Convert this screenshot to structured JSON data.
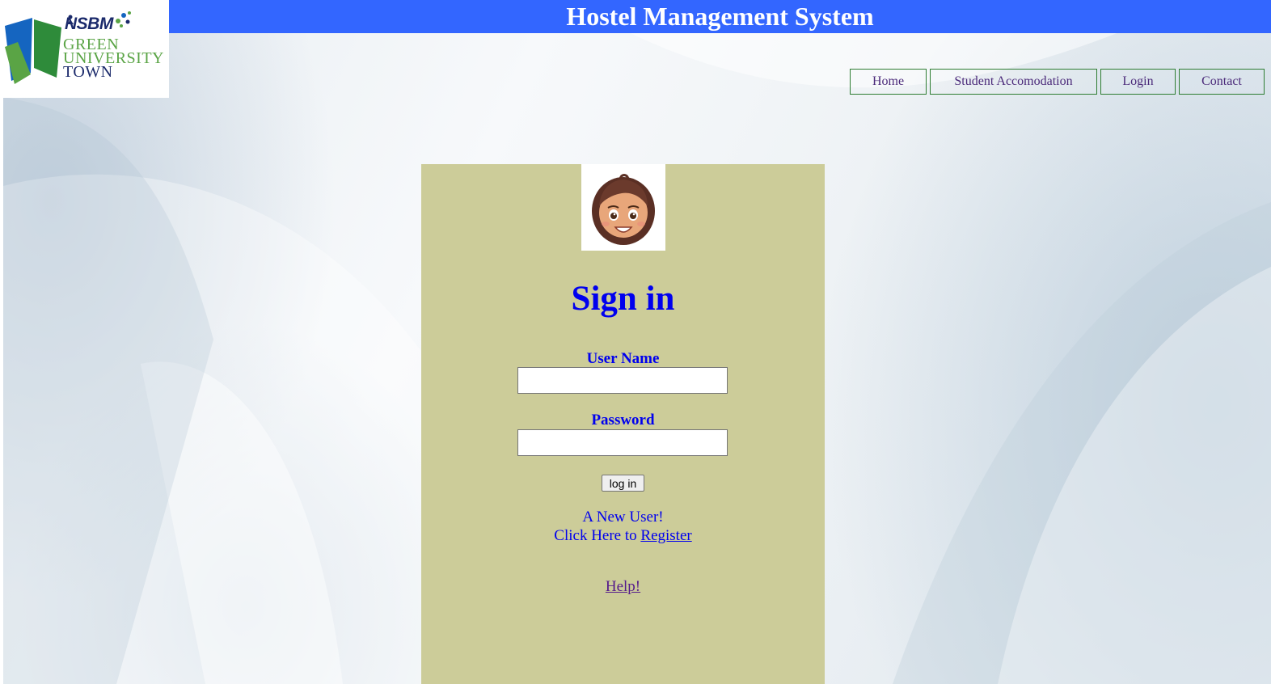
{
  "header": {
    "title": "Hostel Management System"
  },
  "logo": {
    "brand": "NSBM",
    "line1": "GREEN",
    "line2": "UNIVERSITY",
    "line3": "TOWN",
    "colors": {
      "green": "#5aa445",
      "navy": "#1b2a6b",
      "blue": "#1565c0"
    }
  },
  "nav": {
    "items": [
      {
        "label": "Home"
      },
      {
        "label": "Student Accomodation"
      },
      {
        "label": "Login"
      },
      {
        "label": "Contact"
      }
    ]
  },
  "login": {
    "heading": "Sign in",
    "username_label": "User Name",
    "username_value": "",
    "password_label": "Password",
    "password_value": "",
    "submit_label": "log in",
    "new_user_text": "A New User!",
    "register_prefix": "Click Here to ",
    "register_link": "Register",
    "help_link": "Help!",
    "avatar_icon": "user-avatar-icon"
  },
  "colors": {
    "title_bar": "#3366ff",
    "panel": "#cccc99",
    "heading": "#0000ee",
    "nav_border": "#2e7d32"
  }
}
